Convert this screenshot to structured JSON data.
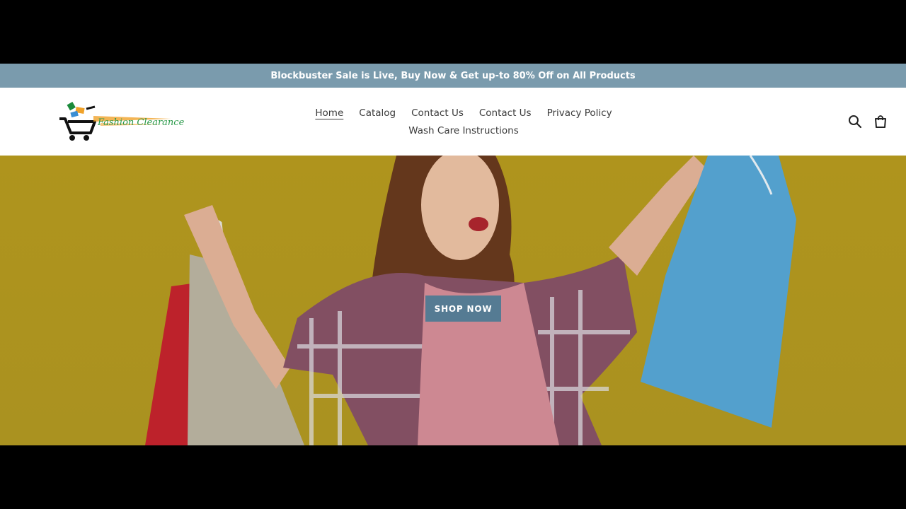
{
  "announcement": {
    "text": "Blockbuster Sale is Live, Buy Now & Get up-to 80% Off on All Products"
  },
  "brand": {
    "name": "Fashion Clearance"
  },
  "nav": {
    "row1": [
      "Home",
      "Catalog",
      "Contact Us",
      "Contact Us",
      "Privacy Policy"
    ],
    "row2": [
      "Wash Care Instructions"
    ],
    "active": "Home"
  },
  "icons": {
    "search": "search-icon",
    "cart": "cart-icon"
  },
  "hero": {
    "button_label": "SHOP NOW"
  },
  "colors": {
    "announcement_bg": "#7a9bad",
    "button_bg": "#557b93",
    "hero_bg": "#b99c1f"
  }
}
